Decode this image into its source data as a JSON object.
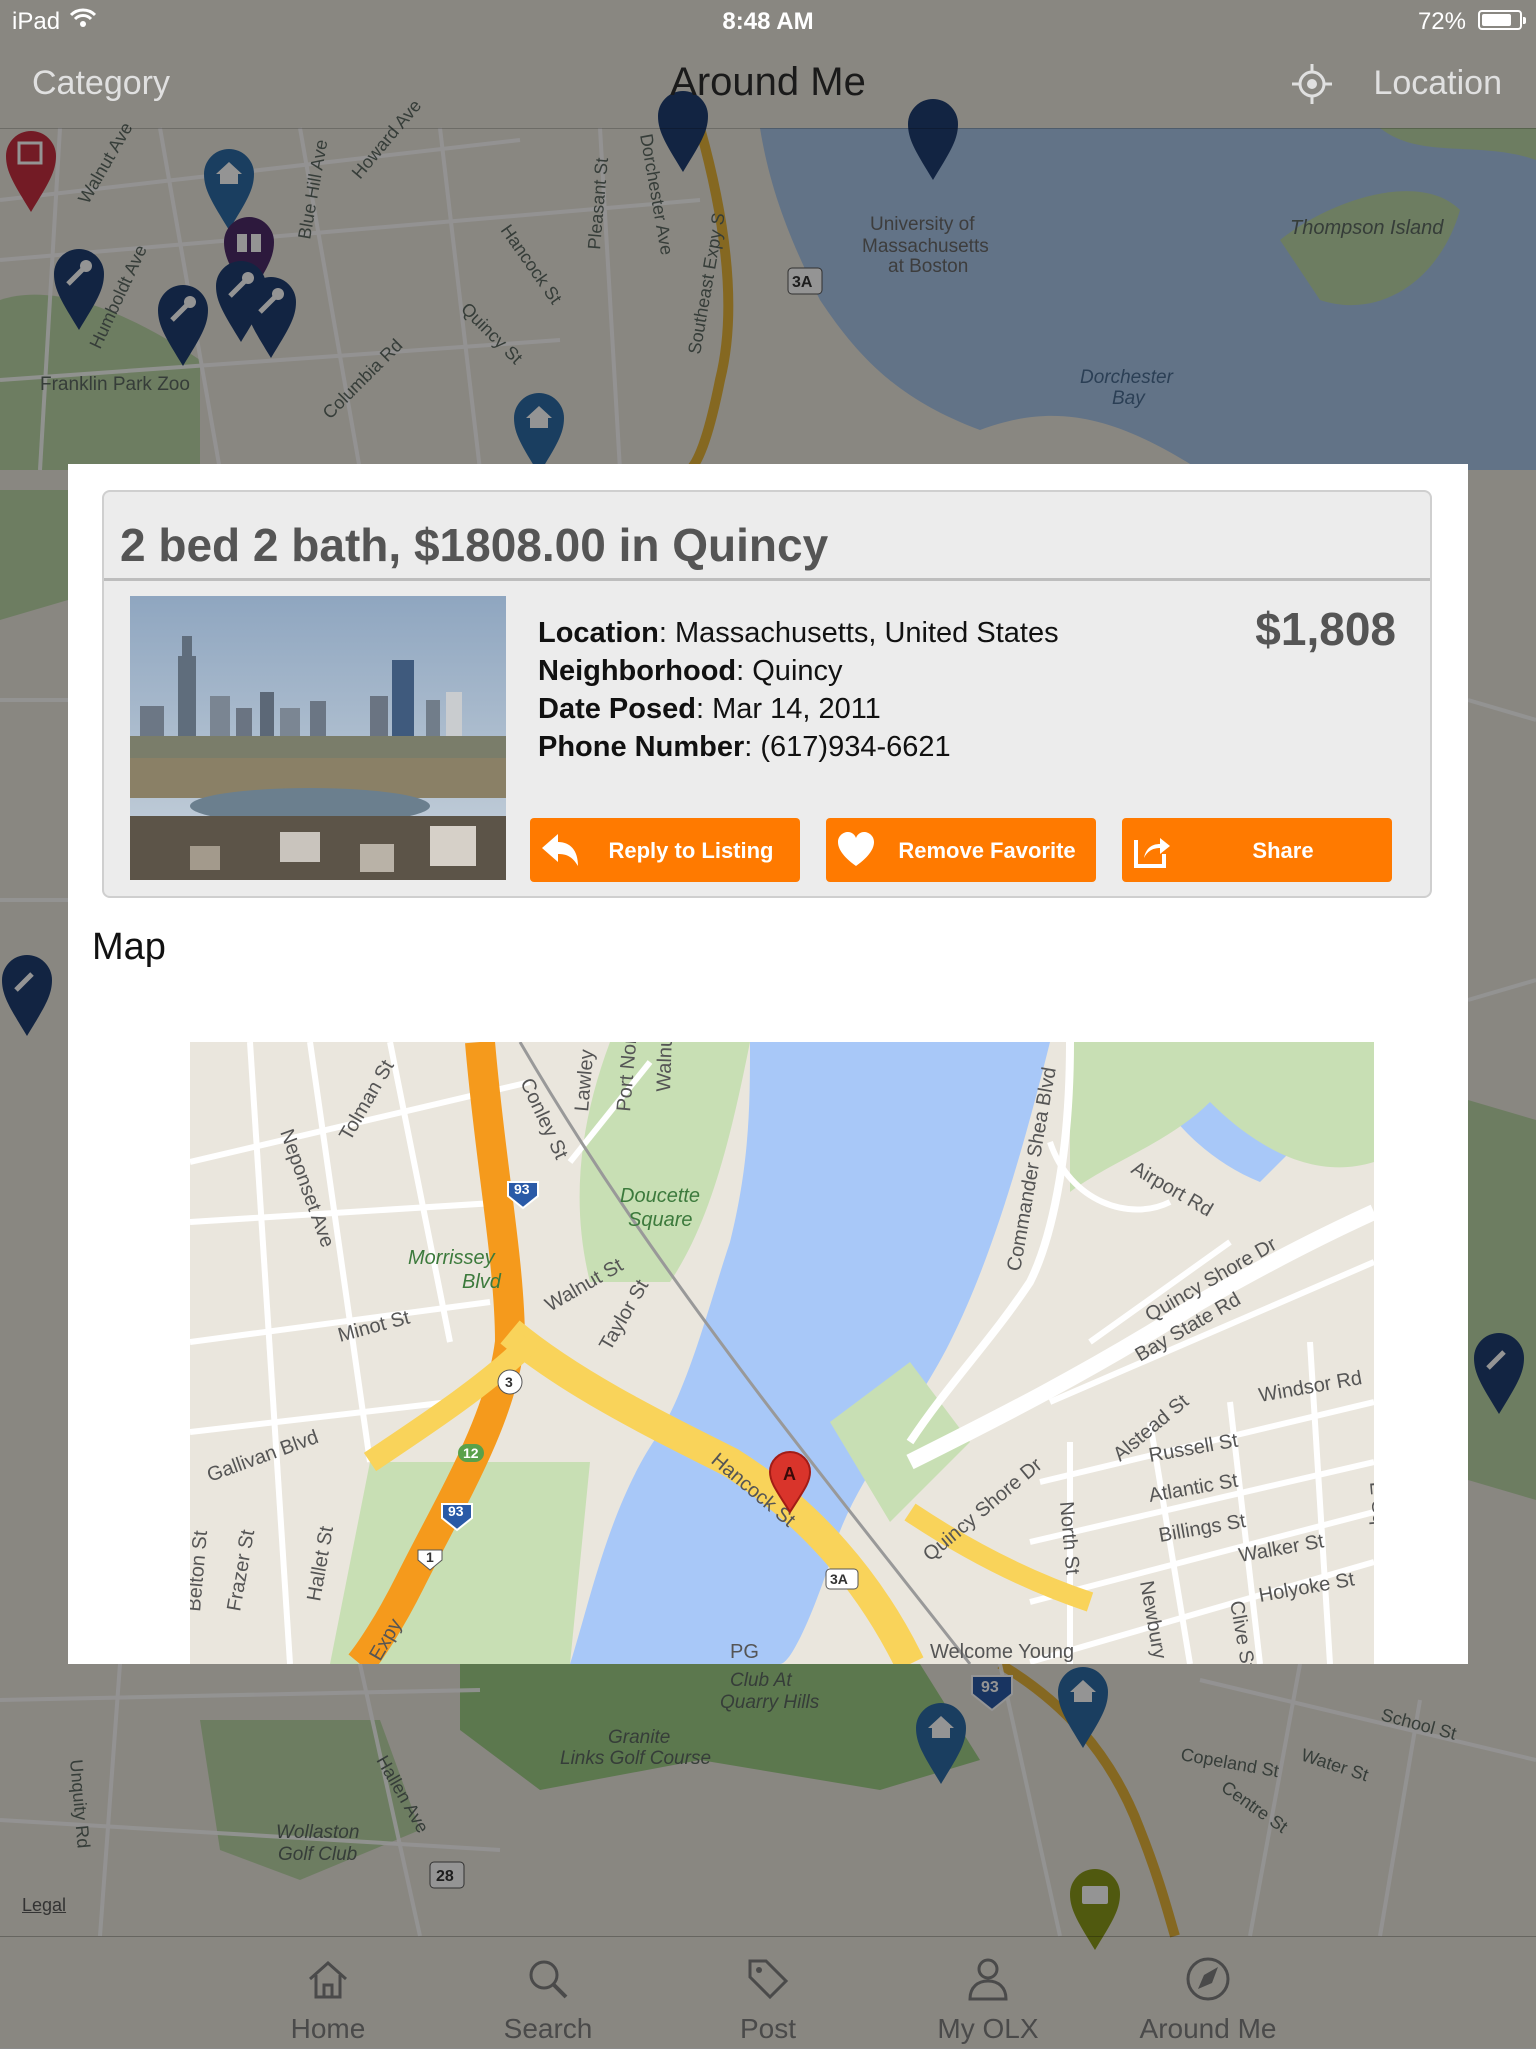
{
  "status_bar": {
    "carrier": "iPad",
    "time": "8:48 AM",
    "battery": "72%"
  },
  "nav": {
    "left": "Category",
    "title": "Around Me",
    "right": "Location"
  },
  "background_map": {
    "labels": [
      "Walnut Ave",
      "Blue Hill Ave",
      "Howard Ave",
      "Humboldt Ave",
      "Pleasant St",
      "Dorchester Ave",
      "Southeast Expy S",
      "Hancock St",
      "Quincy St",
      "Columbia Rd",
      "Franklin Park Zoo",
      "University of Massachusetts at Boston",
      "Thompson Island",
      "Dorchester Bay",
      "Granite Links Golf Course",
      "Wollaston Golf Club",
      "Quarry Hills",
      "School St",
      "Copeland St",
      "Water St",
      "Centre St",
      "Hallen Ave",
      "Unquity Rd",
      "3A",
      "28",
      "93"
    ],
    "legal": "Legal"
  },
  "listing": {
    "title": "2 bed 2 bath, $1808.00 in Quincy",
    "price": "$1,808",
    "location_label": "Location",
    "location_value": ": Massachusetts, United States",
    "neighborhood_label": "Neighborhood",
    "neighborhood_value": ": Quincy",
    "date_label": "Date Posed",
    "date_value": ": Mar 14, 2011",
    "phone_label": "Phone Number",
    "phone_value": ": (617)934-6621",
    "buttons": {
      "reply": "Reply to Listing",
      "favorite": "Remove Favorite",
      "share": "Share"
    },
    "map_heading": "Map"
  },
  "inner_map": {
    "labels": [
      "Neponset Ave",
      "Tolman St",
      "Conley St",
      "Lawley",
      "Port Norfolk",
      "Walnut St",
      "Doucette Square",
      "Morrissey Blvd",
      "Minot St",
      "Walnut St",
      "Taylor St",
      "Gallivan Blvd",
      "Hallet St",
      "Frazer St",
      "Belton St",
      "Hancock St",
      "Quincy Shore Dr",
      "Commander Shea Blvd",
      "Airport Rd",
      "Bay State Rd",
      "Alstead St",
      "Windsor Rd",
      "Russell St",
      "Atlantic St",
      "Billings St",
      "Walker St",
      "Holyoke St",
      "North St",
      "Newbury Av",
      "Clive St",
      "E Squantum",
      "Welcome Young",
      "PG",
      "Expy"
    ],
    "shields": [
      "93",
      "93",
      "3",
      "12",
      "93",
      "1",
      "3A"
    ],
    "marker": "A"
  },
  "tabs": [
    {
      "label": "Home",
      "icon": "home-icon"
    },
    {
      "label": "Search",
      "icon": "search-icon"
    },
    {
      "label": "Post",
      "icon": "tag-icon"
    },
    {
      "label": "My OLX",
      "icon": "person-icon"
    },
    {
      "label": "Around Me",
      "icon": "navigation-arrow-icon"
    }
  ],
  "colors": {
    "accent": "#ff7a00",
    "water": "#a8c8f8",
    "park": "#c8dfb4",
    "highway": "#f9a825",
    "road_major": "#fbd762"
  }
}
